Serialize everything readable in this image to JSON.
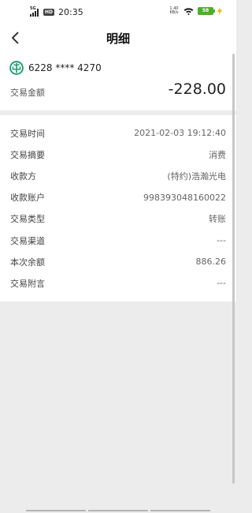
{
  "status_bar": {
    "network": "5G",
    "hd": "HD",
    "time": "20:35",
    "net_speed_value": "1.40",
    "net_speed_unit": "KB/s",
    "battery": "58",
    "battery_color": "#4caf2a"
  },
  "nav": {
    "title": "明细"
  },
  "summary": {
    "account_number": "6228 **** 4270",
    "amount_label": "交易金额",
    "amount": "-228.00",
    "logo_color": "#1a9a6b"
  },
  "details": [
    {
      "label": "交易时间",
      "value": "2021-02-03 19:12:40"
    },
    {
      "label": "交易摘要",
      "value": "消费"
    },
    {
      "label": "收款方",
      "value": "(特约)浩瀚光电"
    },
    {
      "label": "收款账户",
      "value": "998393048160022"
    },
    {
      "label": "交易类型",
      "value": "转账"
    },
    {
      "label": "交易渠道",
      "value": "---"
    },
    {
      "label": "本次余额",
      "value": "886.26"
    },
    {
      "label": "交易附言",
      "value": "---"
    }
  ]
}
